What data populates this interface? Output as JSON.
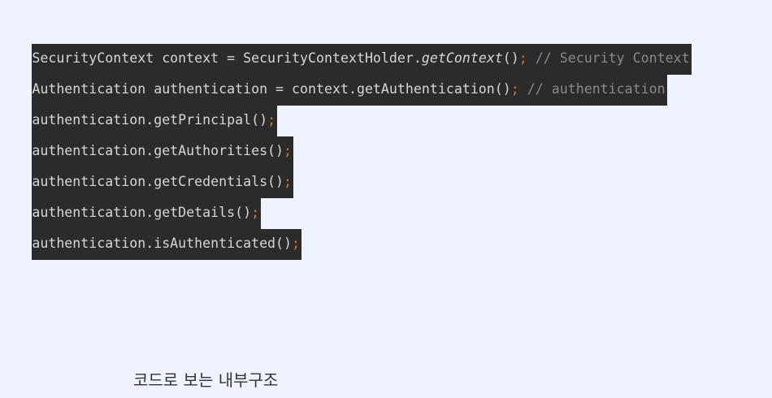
{
  "code": {
    "lines": [
      {
        "before": "SecurityContext context = SecurityContextHolder.",
        "italic": "getContext",
        "after": "()",
        "semicolon": ";",
        "comment": " // Security Context"
      },
      {
        "before": "Authentication authentication = context.getAuthentication()",
        "semicolon": ";",
        "comment": " // authentication"
      },
      {
        "before": "authentication.getPrincipal()",
        "semicolon": ";"
      },
      {
        "before": "authentication.getAuthorities()",
        "semicolon": ";"
      },
      {
        "before": "authentication.getCredentials()",
        "semicolon": ";"
      },
      {
        "before": "authentication.getDetails()",
        "semicolon": ";"
      },
      {
        "before": "authentication.isAuthenticated()",
        "semicolon": ";"
      }
    ]
  },
  "caption": "코드로 보는 내부구조",
  "colors": {
    "page_background": "#eef3fd",
    "code_background": "#2b2b2b",
    "code_text": "#d6d6d6",
    "semicolon": "#cc7832",
    "comment": "#8a8a8a"
  }
}
